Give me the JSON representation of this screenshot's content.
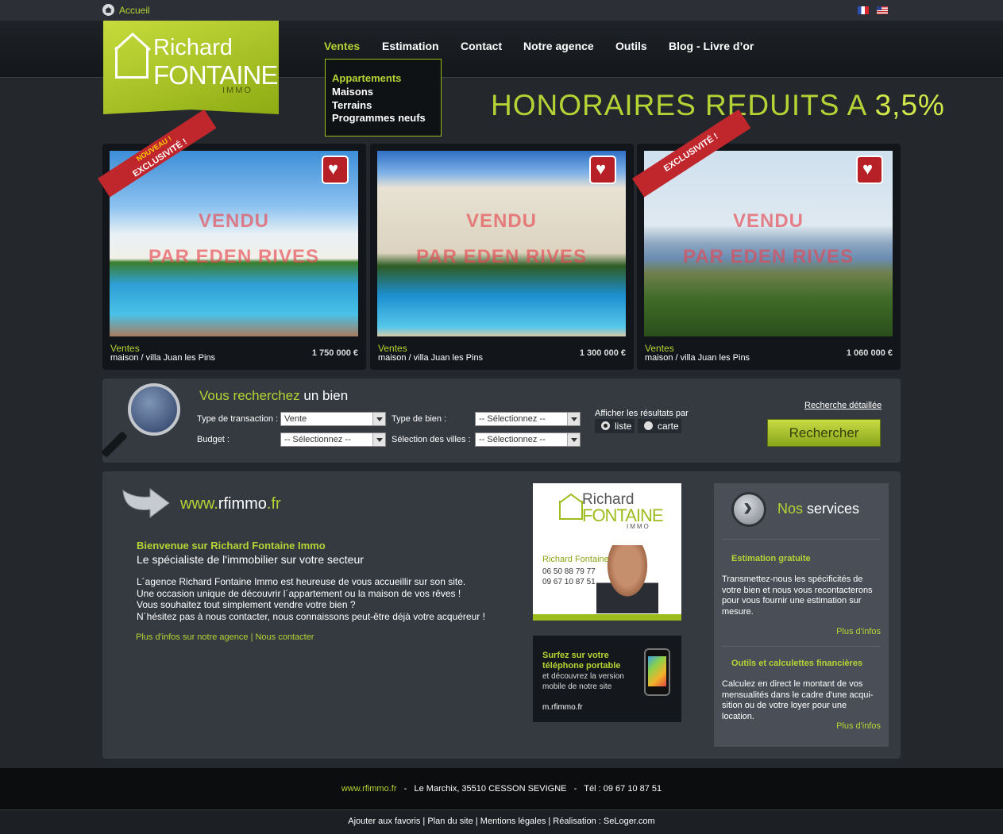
{
  "topbar": {
    "home_label": "Accueil"
  },
  "logo": {
    "line1": "Richard",
    "line2": "FONTAINE",
    "line3": "IMMO"
  },
  "nav": [
    "Ventes",
    "Estimation",
    "Contact",
    "Notre agence",
    "Outils",
    "Blog - Livre d’or"
  ],
  "dropdown": [
    "Appartements",
    "Maisons",
    "Terrains",
    "Programmes neufs"
  ],
  "tagline": {
    "text": "HONORAIRES REDUITS A",
    "value": "3,5%"
  },
  "listings": [
    {
      "ribbon_top": "NOUVEAU !",
      "ribbon": "EXCLUSIVITÉ !",
      "overlay1": "VENDU",
      "overlay2": "PAR EDEN RIVES",
      "category": "Ventes",
      "description": "maison / villa Juan les Pins",
      "price": "1 750 000 €"
    },
    {
      "ribbon_top": "",
      "ribbon": "",
      "overlay1": "VENDU",
      "overlay2": "PAR EDEN RIVES",
      "category": "Ventes",
      "description": "maison / villa Juan les Pins",
      "price": "1 300 000 €"
    },
    {
      "ribbon_top": "",
      "ribbon": "EXCLUSIVITÉ !",
      "overlay1": "VENDU",
      "overlay2": "PAR EDEN RIVES",
      "category": "Ventes",
      "description": "maison / villa Juan les Pins",
      "price": "1 060 000 €"
    }
  ],
  "search": {
    "title_green": "Vous recherchez",
    "title_white": "un bien",
    "transaction_label": "Type de transaction :",
    "transaction_value": "Vente",
    "bien_label": "Type de bien :",
    "bien_value": "-- Sélectionnez --",
    "budget_label": "Budget :",
    "budget_value": "-- Sélectionnez --",
    "villes_label": "Sélection des villes :",
    "villes_value": "-- Sélectionnez --",
    "results_label": "Afficher les résultats par",
    "radio_list": "liste",
    "radio_map": "carte",
    "advanced_link": "Recherche détaillée",
    "button": "Rechercher"
  },
  "intro": {
    "site_prefix": "www.",
    "site_name": "rfimmo",
    "site_suffix": ".fr",
    "welcome": "Bienvenue sur Richard Fontaine Immo",
    "specialist": "Le spécialiste de l'immobilier sur votre secteur",
    "paragraph": [
      "L´agence Richard Fontaine Immo est heureuse de vous accueillir sur son site.",
      "Une occasion unique de découvrir l´appartement ou la maison de vos rêves !",
      "Vous souhaitez tout simplement vendre votre bien ?",
      "N´hésitez pas à nous contacter, nous connaissons peut-être déjà votre acquéreur !"
    ],
    "links": "Plus d'infos sur notre agence | Nous contacter"
  },
  "profile": {
    "logo1": "Richard",
    "logo2": "FONTAINE",
    "logo3": "IMMO",
    "name": "Richard Fontaine",
    "phone1": "06 50 88 79 77",
    "phone2": "09 67 10 87 51"
  },
  "mobile": {
    "title1": "Surfez sur votre",
    "title2": "téléphone portable",
    "text1": "et découvrez la version",
    "text2": "mobile de notre site",
    "url": "m.rfimmo.fr"
  },
  "services": {
    "title_green": "Nos",
    "title_white": "services",
    "items": [
      {
        "heading": "Estimation gratuite",
        "lines": [
          "Transmettez-nous les spécificités de",
          "votre bien et nous vous recontacterons",
          "pour vous fournir une estimation sur",
          "mesure."
        ],
        "more": "Plus d'infos"
      },
      {
        "heading": "Outils et calculettes financières",
        "lines": [
          "Calculez en direct le montant de vos",
          "mensualités dans le cadre d'une acqui-",
          "sition ou de votre loyer pour une location."
        ],
        "more": "Plus d'infos"
      }
    ]
  },
  "footer": {
    "site": "www.rfimmo.fr",
    "address": "Le Marchix, 35510 CESSON SEVIGNE",
    "phone": "Tél : 09 67 10 87 51",
    "links": "Ajouter aux favoris | Plan du site | Mentions légales | Réalisation : SeLoger.com"
  },
  "colors": {
    "accent": "#b5d335",
    "background": "#24282d",
    "panel": "#353a41"
  }
}
